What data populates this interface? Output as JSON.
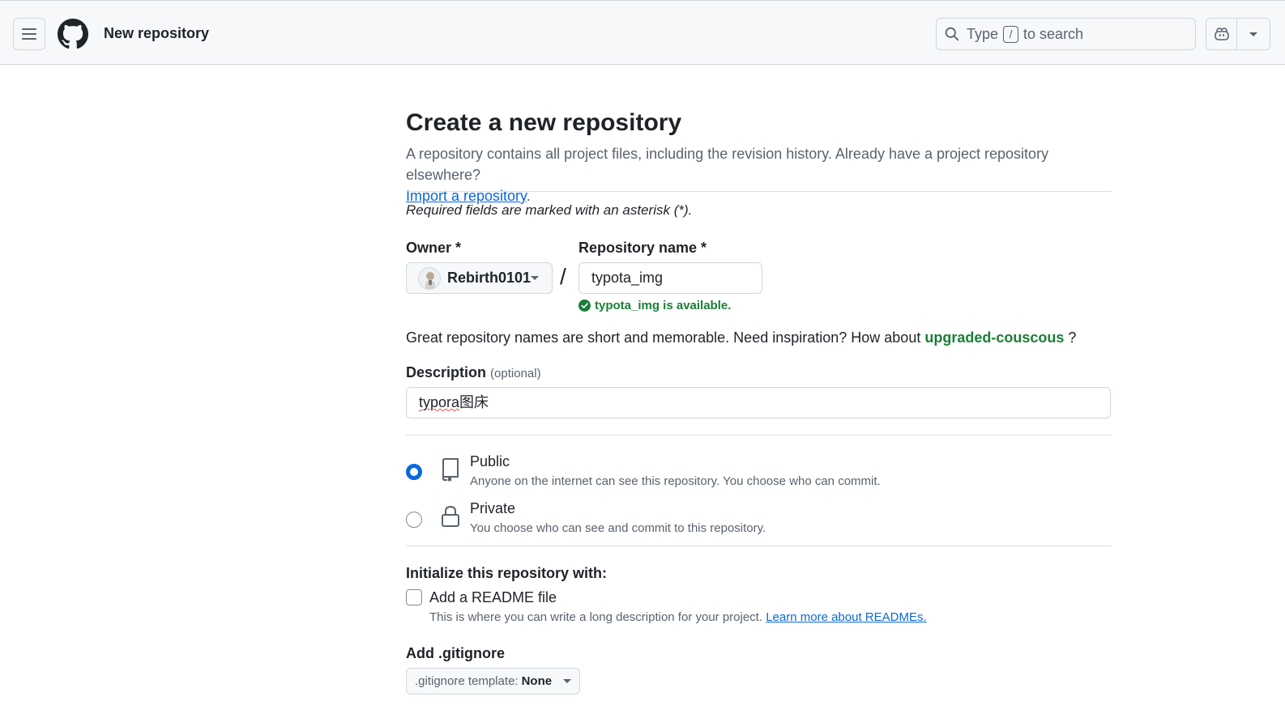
{
  "header": {
    "title": "New repository",
    "search": {
      "text_before": "Type",
      "key": "/",
      "text_after": "to search"
    }
  },
  "main": {
    "page_title": "Create a new repository",
    "intro_text": "A repository contains all project files, including the revision history. Already have a project repository elsewhere?",
    "import_link": "Import a repository",
    "intro_end": ".",
    "required_note": "Required fields are marked with an asterisk (*).",
    "owner_label": "Owner *",
    "owner_value": "Rebirth0101",
    "slash": "/",
    "repo_label": "Repository name *",
    "repo_value": "typota_img",
    "availability": "typota_img is available.",
    "suggest_text": "Great repository names are short and memorable. Need inspiration? How about",
    "suggest_name": "upgraded-couscous",
    "suggest_end": "?",
    "description_label": "Description",
    "description_optional": "(optional)",
    "description_value_misspelled": "typora",
    "description_value_rest": "图床",
    "visibility": [
      {
        "title": "Public",
        "desc": "Anyone on the internet can see this repository. You choose who can commit.",
        "selected": true
      },
      {
        "title": "Private",
        "desc": "You choose who can see and commit to this repository.",
        "selected": false
      }
    ],
    "init_label": "Initialize this repository with:",
    "readme_label": "Add a README file",
    "readme_desc": "This is where you can write a long description for your project.",
    "readme_link": "Learn more about READMEs.",
    "gitignore_label": "Add .gitignore",
    "gitignore_prefix": ".gitignore template:",
    "gitignore_value": "None"
  },
  "colors": {
    "accent": "#0969da",
    "success": "#1a7f37",
    "border": "#d0d7de",
    "header_bg": "#f6f8fa"
  }
}
